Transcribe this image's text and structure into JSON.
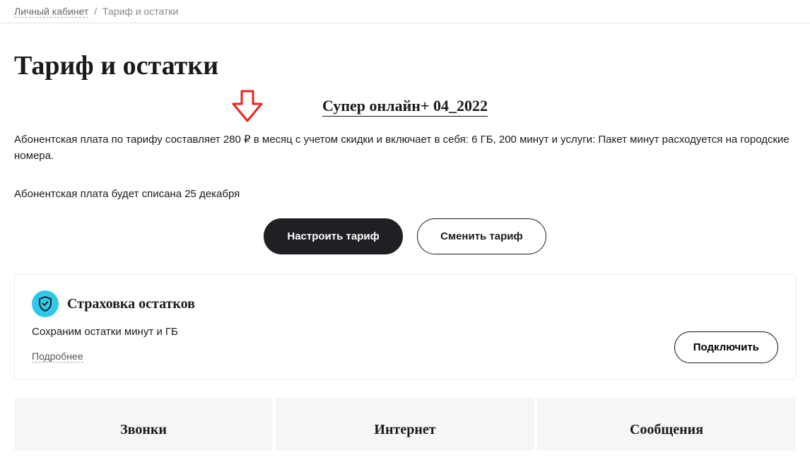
{
  "breadcrumb": {
    "home": "Личный кабинет",
    "current": "Тариф и остатки"
  },
  "page_title": "Тариф и остатки",
  "tariff_name": "Супер онлайн+ 04_2022",
  "description": "Абонентская плата по тарифу составляет 280 ₽ в месяц с учетом скидки и включает в себя: 6 ГБ, 200 минут и услуги: Пакет минут расходуется на городские номера.",
  "charge_note": "Абонентская плата будет списана 25 декабря",
  "buttons": {
    "configure": "Настроить тариф",
    "change": "Сменить тариф"
  },
  "insurance": {
    "title": "Страховка остатков",
    "subtitle": "Сохраним остатки минут и ГБ",
    "more": "Подробнее",
    "connect": "Подключить"
  },
  "tabs": {
    "calls": "Звонки",
    "internet": "Интернет",
    "messages": "Сообщения"
  },
  "annotation": {
    "arrow_color": "#e8261e"
  }
}
